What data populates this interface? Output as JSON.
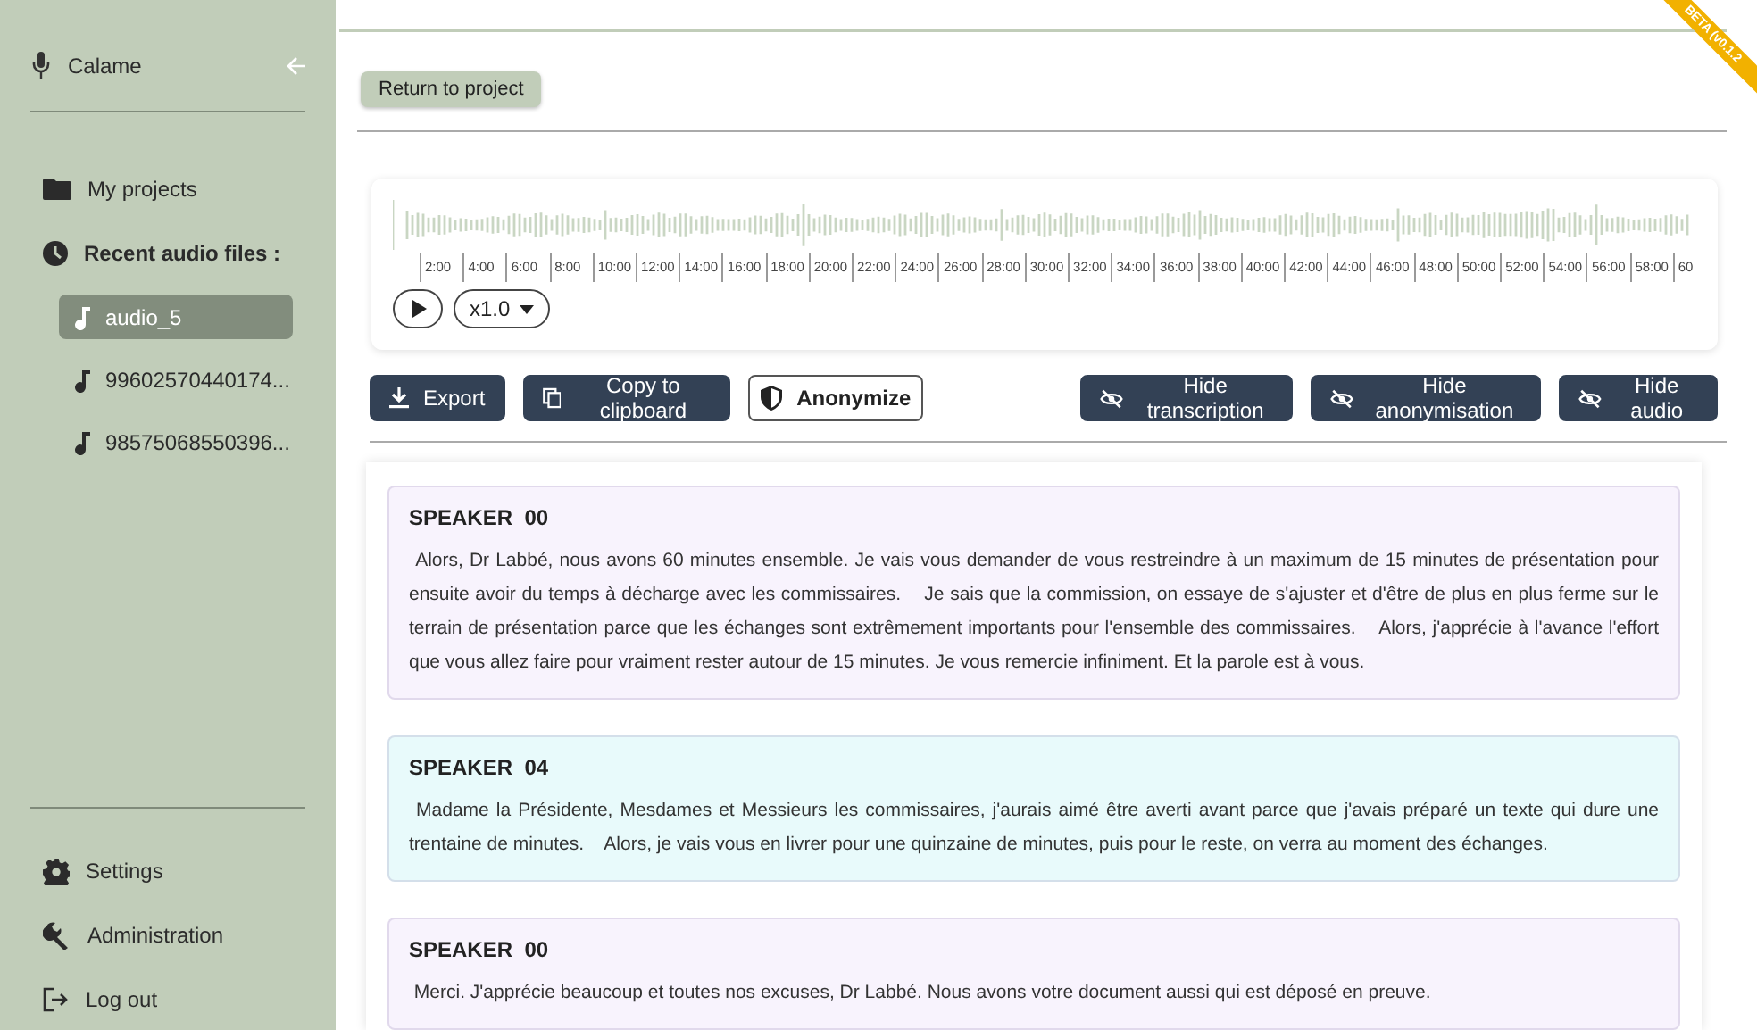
{
  "sidebar": {
    "app_name": "Calame",
    "projects_label": "My projects",
    "recent_label": "Recent audio files :",
    "recent_files": [
      {
        "name": "audio_5",
        "selected": true
      },
      {
        "name": "99602570440174...",
        "selected": false
      },
      {
        "name": "98575068550396...",
        "selected": false
      }
    ],
    "settings_label": "Settings",
    "administration_label": "Administration",
    "logout_label": "Log out"
  },
  "beta_ribbon": "BETA (v0.1.2",
  "return_button": "Return to project",
  "player": {
    "ticks": [
      "2:00",
      "4:00",
      "6:00",
      "8:00",
      "10:00",
      "12:00",
      "14:00",
      "16:00",
      "18:00",
      "20:00",
      "22:00",
      "24:00",
      "26:00",
      "28:00",
      "30:00",
      "32:00",
      "34:00",
      "36:00",
      "38:00",
      "40:00",
      "42:00",
      "44:00",
      "46:00",
      "48:00",
      "50:00",
      "52:00",
      "54:00",
      "56:00",
      "58:00",
      "60"
    ],
    "speed": "x1.0"
  },
  "actions": [
    {
      "label": "Export",
      "kind": "export"
    },
    {
      "label": "Copy to clipboard",
      "kind": "copy"
    },
    {
      "label": "Anonymize",
      "kind": "anonymize"
    },
    {
      "label": "Hide transcription",
      "kind": "hide"
    },
    {
      "label": "Hide anonymisation",
      "kind": "hide"
    },
    {
      "label": "Hide audio",
      "kind": "hide"
    }
  ],
  "segments": [
    {
      "speaker": "SPEAKER_00",
      "color": "#f8f3fd",
      "text": " Alors, Dr Labbé, nous avons 60 minutes ensemble. Je vais vous demander de vous restreindre à un maximum de 15 minutes de présentation pour ensuite avoir du temps à décharge avec les commissaires.    Je sais que la commission, on essaye de s'ajuster et d'être de plus en plus ferme sur le terrain de présentation parce que les échanges sont extrêmement importants pour l'ensemble des commissaires.    Alors, j'apprécie à l'avance l'effort que vous allez faire pour vraiment rester autour de 15 minutes. Je vous remercie infiniment. Et la parole est à vous."
    },
    {
      "speaker": "SPEAKER_04",
      "color": "#e8fafb",
      "text": " Madame la Présidente, Mesdames et Messieurs les commissaires, j'aurais aimé être averti avant parce que j'avais préparé un texte qui dure une trentaine de minutes.    Alors, je vais vous en livrer pour une quinzaine de minutes, puis pour le reste, on verra au moment des échanges."
    },
    {
      "speaker": "SPEAKER_00",
      "color": "#f8f3fd",
      "text": " Merci. J'apprécie beaucoup et toutes nos excuses, Dr Labbé. Nous avons votre document aussi qui est déposé en preuve."
    }
  ]
}
